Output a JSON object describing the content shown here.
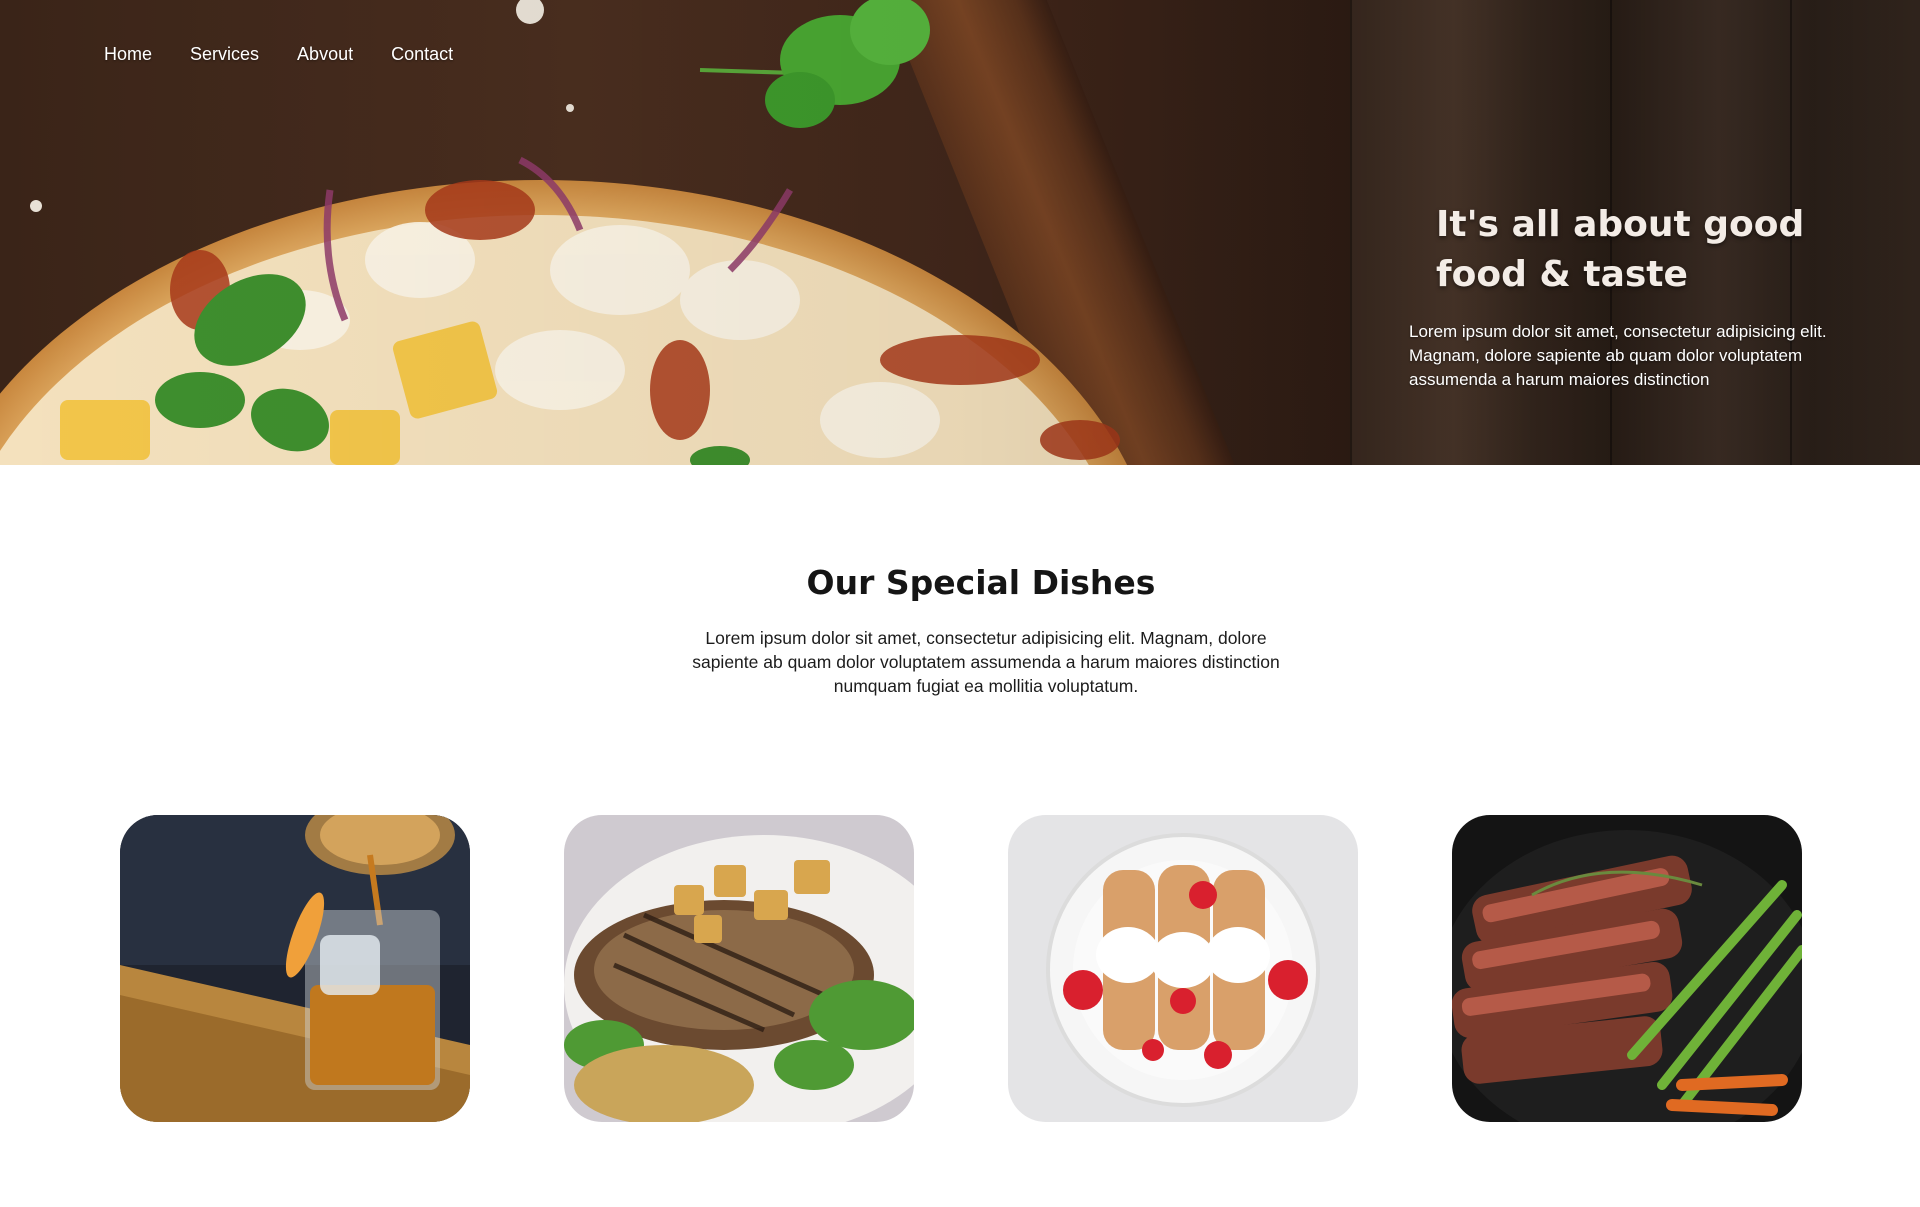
{
  "nav": {
    "items": [
      "Home",
      "Services",
      "Abvout",
      "Contact"
    ]
  },
  "hero": {
    "title_line1": "It's all about good",
    "title_line2": "food & taste",
    "description": "Lorem ipsum dolor sit amet, consectetur adipisicing elit. Magnam, dolore sapiente ab quam dolor voluptatem assumenda a harum maiores distinction"
  },
  "dishes": {
    "title": "Our Special Dishes",
    "description": "Lorem ipsum dolor sit amet, consectetur adipisicing elit. Magnam, dolore sapiente ab quam dolor voluptatem assumenda a harum maiores distinction numquam fugiat ea mollitia voluptatum.",
    "items": [
      {
        "image": "whiskey-glass-photo"
      },
      {
        "image": "grilled-pork-chop-photo"
      },
      {
        "image": "crepes-strawberries-photo"
      },
      {
        "image": "sliced-steak-asparagus-photo"
      }
    ]
  },
  "colors": {
    "hero_wood": "#3a2418",
    "text_dark": "#151515",
    "hero_text": "#ffffff"
  }
}
